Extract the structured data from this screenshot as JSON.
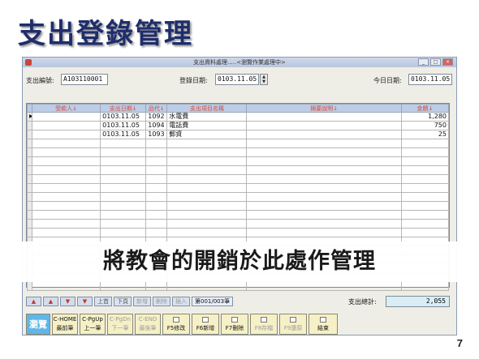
{
  "slide": {
    "title": "支出登錄管理",
    "overlay_text": "將教會的開銷於此處作管理",
    "page_number": "7"
  },
  "window": {
    "title": "支出資料處理.....<瀏覽作業處理中>",
    "buttons": [
      "_",
      "□",
      "×"
    ]
  },
  "header": {
    "id_label": "支出編號:",
    "id_value": "A103110001",
    "date_label": "登錄日期:",
    "date_value": "0103.11.05",
    "today_label": "今日日期:",
    "today_value": "0103.11.05"
  },
  "grid": {
    "columns": [
      "受款人↓",
      "支出日期↓",
      "品代↓",
      "支出項目名稱",
      "摘要說明↓",
      "金額↓"
    ],
    "rows": [
      {
        "payee": "",
        "date": "0103.11.05",
        "code": "1092",
        "item": "水電費",
        "note": "",
        "amount": "1,280"
      },
      {
        "payee": "",
        "date": "0103.11.05",
        "code": "1094",
        "item": "電話費",
        "note": "",
        "amount": "750"
      },
      {
        "payee": "",
        "date": "0103.11.05",
        "code": "1093",
        "item": "郵資",
        "note": "",
        "amount": "25"
      }
    ],
    "empty_rows": 17
  },
  "nav": {
    "first": "上首",
    "next": "下頁",
    "add": "新增",
    "delete": "刪除",
    "insert": "插入",
    "page_indicator": "第001/003筆"
  },
  "total": {
    "label": "支出總計:",
    "value": "2,055"
  },
  "toolbar": {
    "browse": "瀏覽",
    "home_top": "C-HOME",
    "home_bottom": "最前筆",
    "pgup_top": "C-PgUp",
    "pgup_bottom": "上一筆",
    "pgdn_top": "C-PgDn",
    "pgdn_bottom": "下一筆",
    "end_top": "C-END",
    "end_bottom": "最後筆",
    "edit": "F5修改",
    "new": "F6新增",
    "delete": "F7刪除",
    "save": "F8存檔",
    "undo": "F9還原",
    "exit": "結束"
  }
}
